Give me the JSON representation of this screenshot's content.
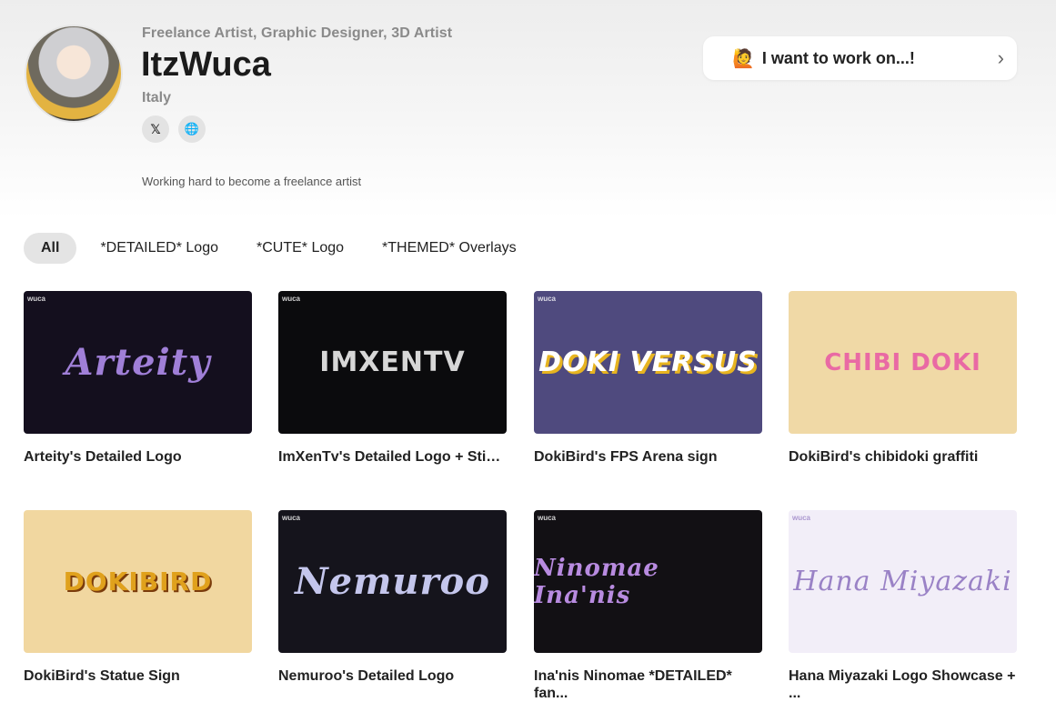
{
  "profile": {
    "roles": "Freelance Artist, Graphic Designer, 3D Artist",
    "name": "ItzWuca",
    "location": "Italy",
    "bio": "Working hard to become a freelance artist",
    "social": [
      {
        "icon": "x-icon",
        "glyph": "𝕏"
      },
      {
        "icon": "globe-icon",
        "glyph": "🌐"
      }
    ]
  },
  "cta": {
    "emoji": "🙋",
    "label": "I want to work on...!",
    "chevron": "›"
  },
  "tabs": [
    {
      "label": "All",
      "active": true
    },
    {
      "label": "*DETAILED* Logo",
      "active": false
    },
    {
      "label": "*CUTE* Logo",
      "active": false
    },
    {
      "label": "*THEMED* Overlays",
      "active": false
    }
  ],
  "gallery": [
    {
      "title": "Arteity's Detailed Logo",
      "art": "Arteity",
      "bg": "#140f1e",
      "fg": "#a07fd8"
    },
    {
      "title": "ImXenTv's Detailed Logo + Stin...",
      "art": "IMXENTV",
      "bg": "#0b0b0d",
      "fg": "#d7d7d7"
    },
    {
      "title": "DokiBird's FPS Arena sign",
      "art": "DOKI VERSUS",
      "bg": "#4f4a7e",
      "fg": "#ffffff"
    },
    {
      "title": "DokiBird's chibidoki graffiti",
      "art": "CHIBI DOKI",
      "bg": "#f0d9a6",
      "fg": "#e96aa4"
    },
    {
      "title": "DokiBird's Statue Sign",
      "art": "DOKIBIRD",
      "bg": "#f1d7a0",
      "fg": "#e0a11c"
    },
    {
      "title": "Nemuroo's Detailed Logo",
      "art": "Nemuroo",
      "bg": "#15141c",
      "fg": "#c4c6ec"
    },
    {
      "title": "Ina'nis Ninomae *DETAILED* fan...",
      "art": "Ninomae Ina'nis",
      "bg": "#121014",
      "fg": "#b88be0"
    },
    {
      "title": "Hana Miyazaki Logo Showcase + ...",
      "art": "Hana Miyazaki",
      "bg": "#f2eef8",
      "fg": "#9a82c6"
    }
  ]
}
